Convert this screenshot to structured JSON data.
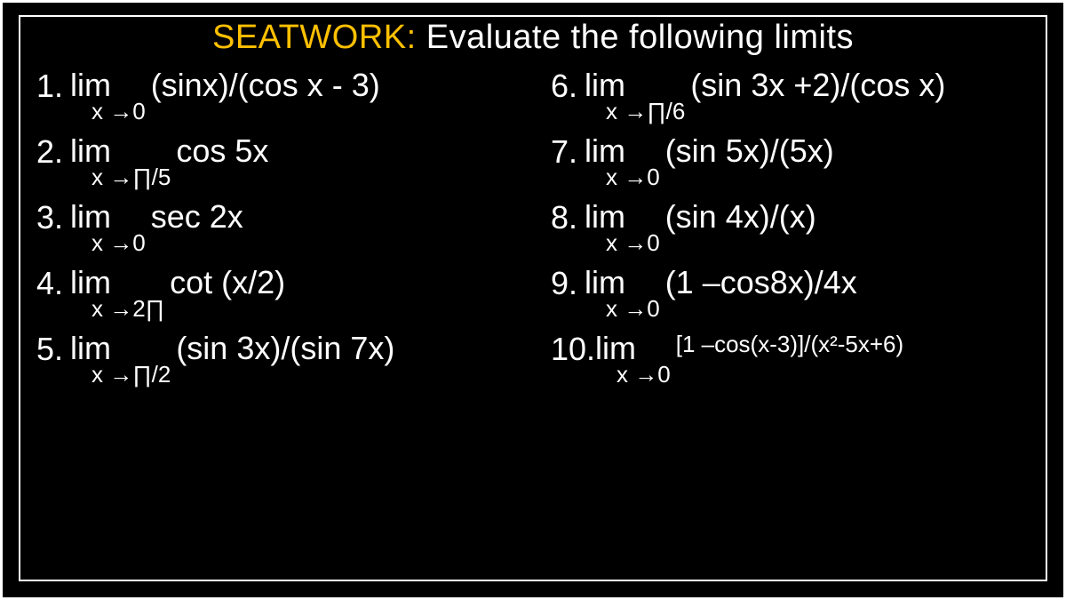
{
  "title": {
    "accent": "SEATWORK:",
    "rest": " Evaluate the following limits"
  },
  "left": [
    {
      "num": "1.",
      "lim": "lim",
      "sub": "x →0",
      "expr": "(sinx)/(cos x - 3)"
    },
    {
      "num": "2.",
      "lim": "lim",
      "sub": "x →∏/5",
      "expr": "cos 5x"
    },
    {
      "num": "3.",
      "lim": "lim",
      "sub": "x →0",
      "expr": "sec 2x"
    },
    {
      "num": "4.",
      "lim": "lim",
      "sub": "x →2∏",
      "expr": "cot (x/2)"
    },
    {
      "num": "5.",
      "lim": "lim",
      "sub": "x →∏/2",
      "expr": "(sin 3x)/(sin 7x)"
    }
  ],
  "right": [
    {
      "num": "6.",
      "lim": "lim",
      "sub": "x →∏/6",
      "expr": "(sin 3x +2)/(cos x)"
    },
    {
      "num": "7.",
      "lim": "lim",
      "sub": "x →0",
      "expr": "(sin 5x)/(5x)"
    },
    {
      "num": "8.",
      "lim": "lim",
      "sub": "x →0",
      "expr": "(sin 4x)/(x)"
    },
    {
      "num": "9.",
      "lim": "lim",
      "sub": "x →0",
      "expr": "(1 –cos8x)/4x"
    },
    {
      "num": "10.",
      "lim": "lim",
      "sub": "x →0",
      "expr": "[1 –cos(x-3)]/(x²-5x+6)",
      "small": true
    }
  ]
}
